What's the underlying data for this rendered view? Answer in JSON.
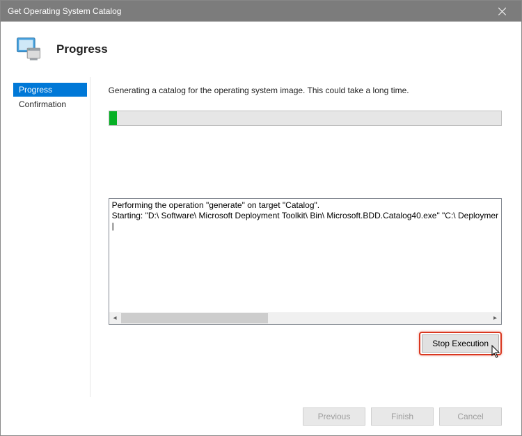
{
  "window": {
    "title": "Get Operating System Catalog"
  },
  "header": {
    "heading": "Progress"
  },
  "sidebar": {
    "steps": [
      {
        "label": "Progress",
        "active": true
      },
      {
        "label": "Confirmation",
        "active": false
      }
    ]
  },
  "main": {
    "status": "Generating a catalog for the operating system image.  This could take a long time.",
    "progress_percent": 2,
    "log_lines": [
      "Performing the operation \"generate\" on target \"Catalog\".",
      "Starting: \"D:\\ Software\\ Microsoft Deployment Toolkit\\ Bin\\ Microsoft.BDD.Catalog40.exe\" \"C:\\ Deploymer"
    ],
    "stop_button": "Stop Execution"
  },
  "footer": {
    "previous": "Previous",
    "finish": "Finish",
    "cancel": "Cancel"
  }
}
